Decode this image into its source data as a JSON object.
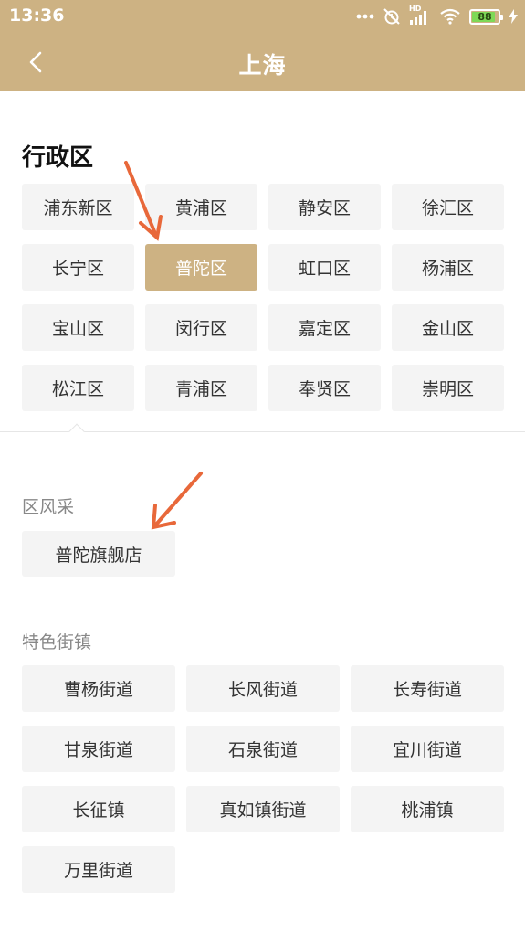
{
  "status_bar": {
    "time": "13:36",
    "battery_level": "88",
    "network_label": "HD"
  },
  "header": {
    "title": "上海",
    "back_icon": "chevron-left-icon"
  },
  "districts": {
    "heading": "行政区",
    "selected": "普陀区",
    "items": [
      "浦东新区",
      "黄浦区",
      "静安区",
      "徐汇区",
      "长宁区",
      "普陀区",
      "虹口区",
      "杨浦区",
      "宝山区",
      "闵行区",
      "嘉定区",
      "金山区",
      "松江区",
      "青浦区",
      "奉贤区",
      "崇明区"
    ]
  },
  "feature": {
    "heading": "区风采",
    "items": [
      "普陀旗舰店"
    ]
  },
  "streets": {
    "heading": "特色街镇",
    "items": [
      "曹杨街道",
      "长风街道",
      "长寿街道",
      "甘泉街道",
      "石泉街道",
      "宜川街道",
      "长征镇",
      "真如镇街道",
      "桃浦镇",
      "万里街道"
    ]
  },
  "colors": {
    "accent": "#cdb283",
    "tag_bg": "#f4f4f4",
    "annotation_arrow": "#e8683a",
    "battery_fill": "#7ed957"
  }
}
